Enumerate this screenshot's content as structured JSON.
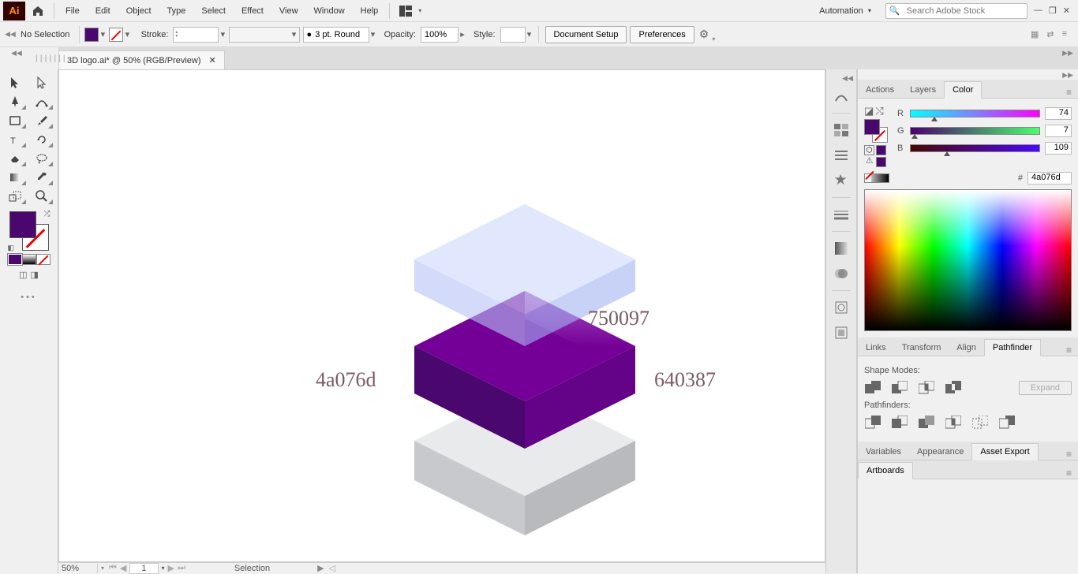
{
  "menubar": {
    "items": [
      "File",
      "Edit",
      "Object",
      "Type",
      "Select",
      "Effect",
      "View",
      "Window",
      "Help"
    ],
    "workspace": "Automation",
    "search_placeholder": "Search Adobe Stock"
  },
  "ctrlbar": {
    "selection": "No Selection",
    "stroke_label": "Stroke:",
    "brush_size": "3 pt. Round",
    "opacity_label": "Opacity:",
    "opacity_val": "100%",
    "style_label": "Style:",
    "doc_setup": "Document Setup",
    "prefs": "Preferences"
  },
  "document": {
    "tab_title": "3D logo.ai* @ 50% (RGB/Preview)",
    "labels": {
      "top": "750097",
      "left": "4a076d",
      "right": "640387"
    }
  },
  "status": {
    "zoom": "50%",
    "artboard": "1",
    "tool": "Selection"
  },
  "panels": {
    "row1": [
      "Actions",
      "Layers",
      "Color"
    ],
    "color": {
      "r": "74",
      "g": "7",
      "b": "109",
      "hex": "4a076d",
      "r_label": "R",
      "g_label": "G",
      "b_label": "B",
      "hash": "#"
    },
    "row2": [
      "Links",
      "Transform",
      "Align",
      "Pathfinder"
    ],
    "pathfinder": {
      "shape_modes": "Shape Modes:",
      "pathfinders": "Pathfinders:",
      "expand": "Expand"
    },
    "row3": [
      "Variables",
      "Appearance",
      "Asset Export"
    ],
    "row4": [
      "Artboards"
    ]
  }
}
